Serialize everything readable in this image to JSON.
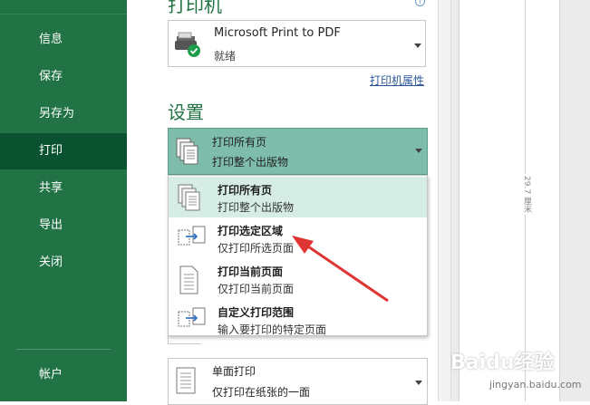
{
  "sidebar": {
    "items": [
      {
        "label": "信息",
        "active": false
      },
      {
        "label": "保存",
        "active": false
      },
      {
        "label": "另存为",
        "active": false
      },
      {
        "label": "打印",
        "active": true
      },
      {
        "label": "共享",
        "active": false
      },
      {
        "label": "导出",
        "active": false
      },
      {
        "label": "关闭",
        "active": false
      }
    ],
    "account": "帐户"
  },
  "printer": {
    "section_title": "打印机",
    "name": "Microsoft Print to PDF",
    "status": "就绪",
    "properties_link": "打印机属性"
  },
  "settings": {
    "section_title": "设置",
    "selected": {
      "title": "打印所有页",
      "subtitle": "打印整个出版物"
    },
    "menu": [
      {
        "title": "打印所有页",
        "subtitle": "打印整个出版物",
        "highlighted": true
      },
      {
        "title": "打印选定区域",
        "subtitle": "仅打印所选页面",
        "highlighted": false
      },
      {
        "title": "打印当前页面",
        "subtitle": "仅打印当前页面",
        "highlighted": false
      },
      {
        "title": "自定义打印范围",
        "subtitle": "输入要打印的特定页面",
        "highlighted": false
      }
    ],
    "sides": {
      "title": "单面打印",
      "subtitle": "仅打印在纸张的一面"
    }
  },
  "preview": {
    "ruler_label": "29.7 厘米"
  },
  "watermark": {
    "text": "Baidu经验",
    "sub": "jingyan.baidu.com"
  },
  "colors": {
    "brand": "#217346",
    "active": "#0a5230",
    "selected": "#7ebdab",
    "arrow": "#e03535"
  }
}
